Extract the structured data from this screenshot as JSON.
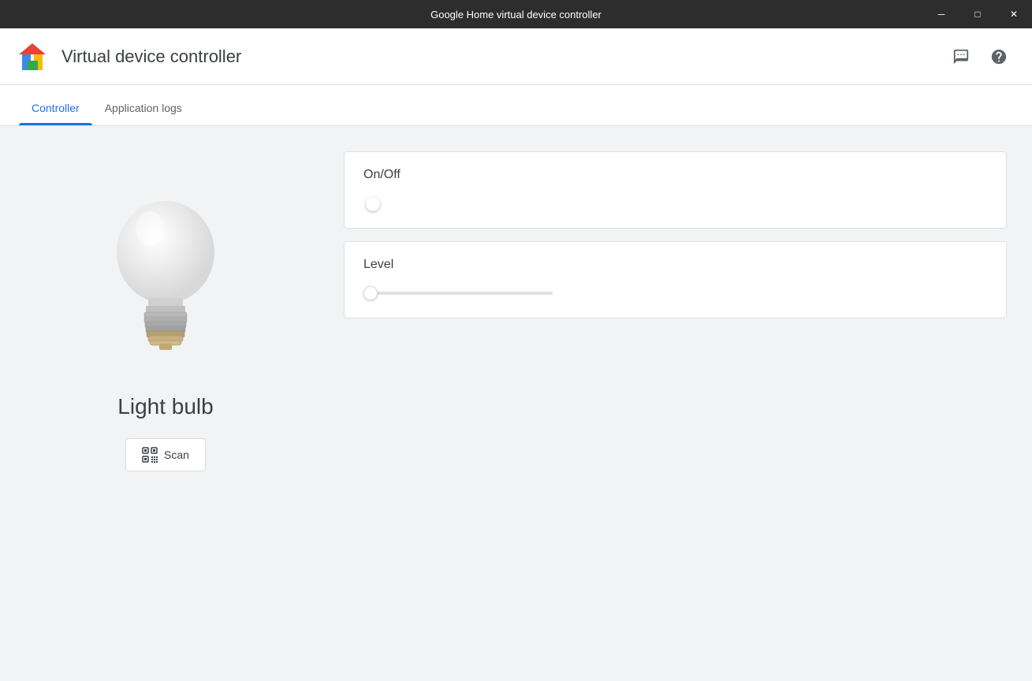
{
  "titleBar": {
    "title": "Google Home virtual device controller",
    "controls": {
      "minimize": "─",
      "maximize": "□",
      "close": "✕"
    }
  },
  "header": {
    "logoAlt": "Google Home logo",
    "appTitle": "Virtual device controller",
    "feedbackIcon": "feedback-icon",
    "helpIcon": "help-icon"
  },
  "tabs": [
    {
      "id": "controller",
      "label": "Controller",
      "active": true
    },
    {
      "id": "application-logs",
      "label": "Application logs",
      "active": false
    }
  ],
  "leftPanel": {
    "deviceName": "Light bulb",
    "scanButton": "Scan"
  },
  "rightPanel": {
    "controls": [
      {
        "id": "on-off",
        "label": "On/Off",
        "type": "toggle",
        "value": false
      },
      {
        "id": "level",
        "label": "Level",
        "type": "slider",
        "value": 0,
        "min": 0,
        "max": 100
      }
    ]
  }
}
